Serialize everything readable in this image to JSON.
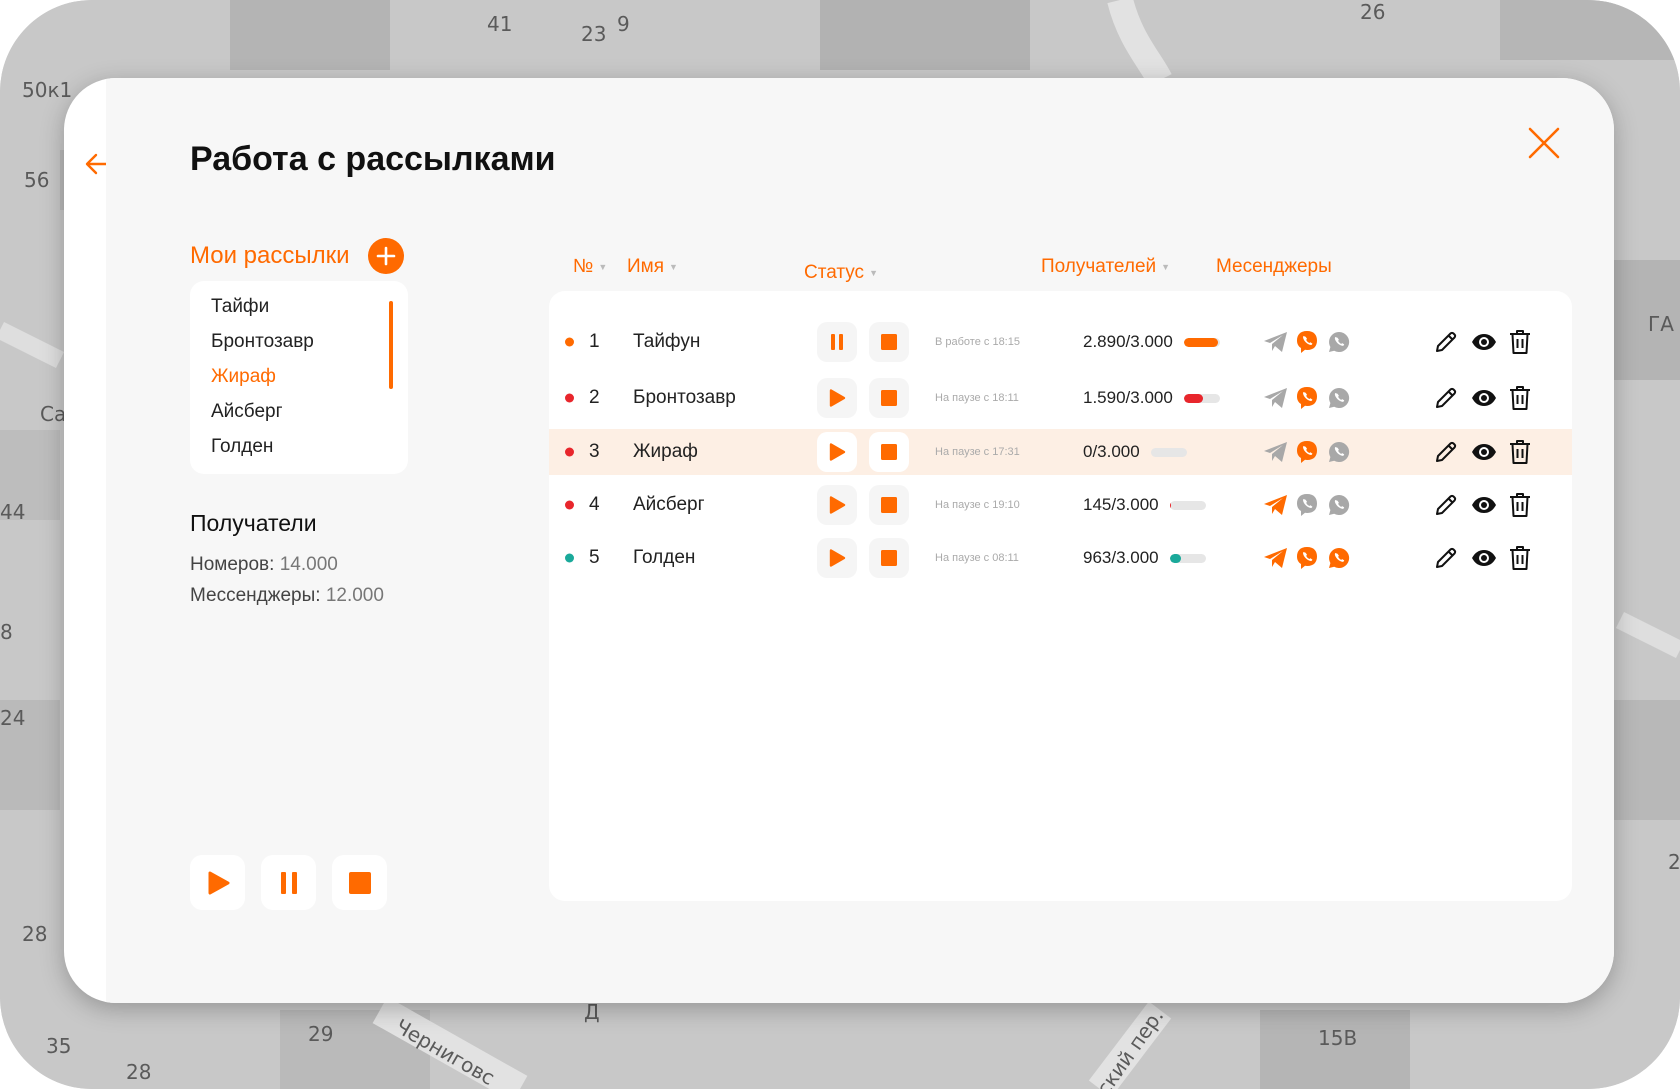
{
  "map": {
    "labels": [
      "41",
      "23",
      "9",
      "26",
      "50к1",
      "56",
      "Са",
      "44",
      "8",
      "24",
      "28",
      "35",
      "29",
      "28",
      "Черниговс",
      "ский пер.",
      "15В",
      "ГА",
      "2",
      "Д"
    ]
  },
  "header": {
    "title": "Работа с рассылками",
    "back_icon": "arrow-left-icon",
    "close_icon": "close-icon"
  },
  "sidebar": {
    "title": "Мои рассылки",
    "add_icon": "plus-icon",
    "items": [
      {
        "label": "Тайфи",
        "active": false
      },
      {
        "label": "Бронтозавр",
        "active": false
      },
      {
        "label": "Жираф",
        "active": true
      },
      {
        "label": "Айсберг",
        "active": false
      },
      {
        "label": "Голден",
        "active": false
      }
    ],
    "recipients": {
      "title": "Получатели",
      "numbers_label": "Номеров:",
      "numbers_value": "14.000",
      "messengers_label": "Мессенджеры:",
      "messengers_value": "12.000"
    },
    "controls": [
      "play-icon",
      "pause-icon",
      "stop-icon"
    ]
  },
  "table": {
    "columns": {
      "num": "№",
      "name": "Имя",
      "status": "Статус",
      "recipients": "Получателей",
      "messengers": "Месенджеры"
    },
    "rows": [
      {
        "num": "1",
        "name": "Тайфун",
        "state": "running",
        "status": "В работе с 18:15",
        "count": "2.890/3.000",
        "progress": 0.96,
        "dot_color": "#ff6a00",
        "bar_color": "#ff6a00",
        "telegram": false,
        "viber": true,
        "whatsapp": false,
        "highlight": false
      },
      {
        "num": "2",
        "name": "Бронтозавр",
        "state": "paused",
        "status": "На паузе с 18:11",
        "count": "1.590/3.000",
        "progress": 0.53,
        "dot_color": "#e8262c",
        "bar_color": "#e8262c",
        "telegram": false,
        "viber": true,
        "whatsapp": false,
        "highlight": false
      },
      {
        "num": "3",
        "name": "Жираф",
        "state": "paused",
        "status": "На паузе с 17:31",
        "count": "0/3.000",
        "progress": 0,
        "dot_color": "#e8262c",
        "bar_color": "#e8262c",
        "telegram": false,
        "viber": true,
        "whatsapp": false,
        "highlight": true
      },
      {
        "num": "4",
        "name": "Айсберг",
        "state": "paused",
        "status": "На паузе с 19:10",
        "count": "145/3.000",
        "progress": 0.05,
        "dot_color": "#e8262c",
        "bar_color": "#e8262c",
        "telegram": true,
        "viber": false,
        "whatsapp": false,
        "highlight": false
      },
      {
        "num": "5",
        "name": "Голден",
        "state": "paused",
        "status": "На паузе с 08:11",
        "count": "963/3.000",
        "progress": 0.32,
        "dot_color": "#1aa99a",
        "bar_color": "#1aa99a",
        "telegram": true,
        "viber": true,
        "whatsapp": true,
        "highlight": false
      }
    ]
  },
  "colors": {
    "accent": "#ff6a00",
    "inactive_icon": "#a8a8a8",
    "highlight_row": "#fdefe4"
  }
}
